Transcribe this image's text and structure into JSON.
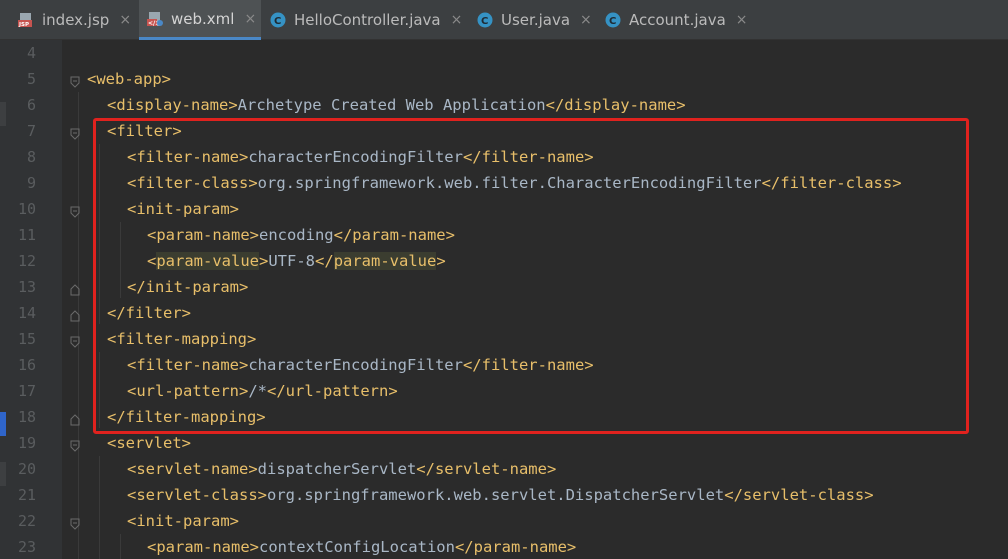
{
  "tabs": [
    {
      "label": "index.jsp",
      "icon": "jsp-file-icon",
      "active": false
    },
    {
      "label": "web.xml",
      "icon": "xml-file-icon",
      "active": true
    },
    {
      "label": "HelloController.java",
      "icon": "java-class-icon",
      "active": false
    },
    {
      "label": "User.java",
      "icon": "java-class-icon",
      "active": false
    },
    {
      "label": "Account.java",
      "icon": "java-class-icon",
      "active": false
    }
  ],
  "close_glyph": "×",
  "colors": {
    "tag": "#e8bf6a",
    "text": "#a9b7c6",
    "annotation_box": "#e0221e",
    "background": "#2b2b2b"
  },
  "lines": [
    {
      "n": "4",
      "text": ""
    },
    {
      "n": "5",
      "text": "<web-app>"
    },
    {
      "n": "6",
      "text": "<display-name>Archetype Created Web Application</display-name>"
    },
    {
      "n": "7",
      "text": "<filter>"
    },
    {
      "n": "8",
      "text": "<filter-name>characterEncodingFilter</filter-name>"
    },
    {
      "n": "9",
      "text": "<filter-class>org.springframework.web.filter.CharacterEncodingFilter</filter-class>"
    },
    {
      "n": "10",
      "text": "<init-param>"
    },
    {
      "n": "11",
      "text": "<param-name>encoding</param-name>"
    },
    {
      "n": "12",
      "text": "<param-value>UTF-8</param-value>"
    },
    {
      "n": "13",
      "text": "</init-param>"
    },
    {
      "n": "14",
      "text": "</filter>"
    },
    {
      "n": "15",
      "text": "<filter-mapping>"
    },
    {
      "n": "16",
      "text": "<filter-name>characterEncodingFilter</filter-name>"
    },
    {
      "n": "17",
      "text": "<url-pattern>/*</url-pattern>"
    },
    {
      "n": "18",
      "text": "</filter-mapping>"
    },
    {
      "n": "19",
      "text": "<servlet>"
    },
    {
      "n": "20",
      "text": "<servlet-name>dispatcherServlet</servlet-name>"
    },
    {
      "n": "21",
      "text": "<servlet-class>org.springframework.web.servlet.DispatcherServlet</servlet-class>"
    },
    {
      "n": "22",
      "text": "<init-param>"
    },
    {
      "n": "23",
      "text": "<param-name>contextConfigLocation</param-name>"
    }
  ]
}
